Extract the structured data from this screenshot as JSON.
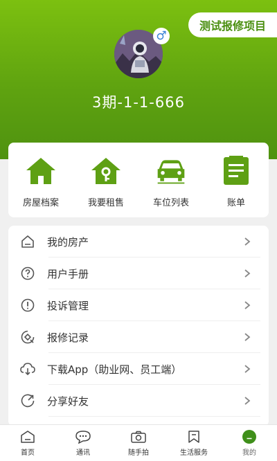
{
  "header": {
    "report_button": "测试报修项目",
    "username": "3期-1-1-666",
    "gender_symbol": "♂"
  },
  "quick_actions": [
    {
      "label": "房屋档案",
      "icon": "house-icon"
    },
    {
      "label": "我要租售",
      "icon": "house-key-icon"
    },
    {
      "label": "车位列表",
      "icon": "car-icon"
    },
    {
      "label": "账单",
      "icon": "bill-icon"
    }
  ],
  "menu": [
    {
      "label": "我的房产",
      "icon": "home-outline-icon"
    },
    {
      "label": "用户手册",
      "icon": "question-circle-icon"
    },
    {
      "label": "投诉管理",
      "icon": "exclamation-circle-icon"
    },
    {
      "label": "报修记录",
      "icon": "repair-record-icon"
    },
    {
      "label": "下载App（助业网、员工端）",
      "icon": "cloud-download-icon"
    },
    {
      "label": "分享好友",
      "icon": "share-icon"
    }
  ],
  "tabbar": [
    {
      "label": "首页",
      "icon": "home-tab-icon"
    },
    {
      "label": "通讯",
      "icon": "chat-icon"
    },
    {
      "label": "随手拍",
      "icon": "camera-icon"
    },
    {
      "label": "生活服务",
      "icon": "bookmark-icon"
    },
    {
      "label": "我的",
      "icon": "profile-icon",
      "active": true
    }
  ],
  "colors": {
    "brand": "#5fa310",
    "gender": "#3b82d6"
  }
}
